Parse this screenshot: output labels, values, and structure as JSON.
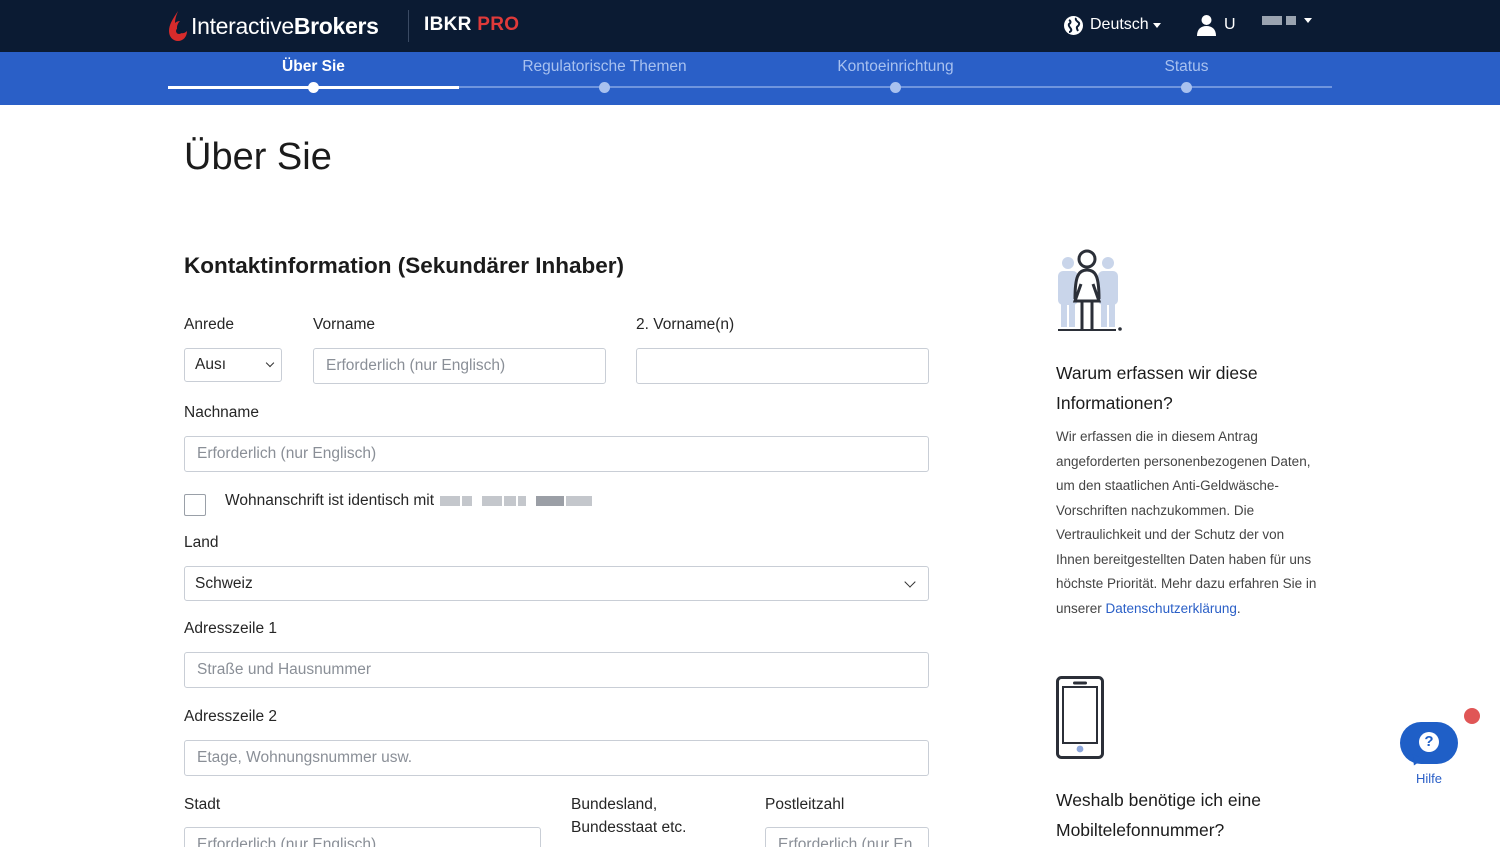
{
  "header": {
    "brand": {
      "light": "Interactive",
      "bold": "Brokers"
    },
    "product": {
      "name": "IBKR",
      "tier": "PRO"
    },
    "language": "Deutsch",
    "user_id": "U"
  },
  "steps": [
    {
      "label": "Über Sie",
      "active": true
    },
    {
      "label": "Regulatorische Themen",
      "active": false
    },
    {
      "label": "Kontoeinrichtung",
      "active": false
    },
    {
      "label": "Status",
      "active": false
    }
  ],
  "page_title": "Über Sie",
  "section_title": "Kontaktinformation (Sekundärer Inhaber)",
  "form": {
    "anrede": {
      "label": "Anrede",
      "value": "Ausı"
    },
    "vorname": {
      "label": "Vorname",
      "placeholder": "Erforderlich (nur Englisch)"
    },
    "vorname2": {
      "label": "2. Vorname(n)",
      "placeholder": ""
    },
    "nachname": {
      "label": "Nachname",
      "placeholder": "Erforderlich (nur Englisch)"
    },
    "same_address": {
      "label": "Wohnanschrift ist identisch mit"
    },
    "land": {
      "label": "Land",
      "value": "Schweiz"
    },
    "adresse1": {
      "label": "Adresszeile 1",
      "placeholder": "Straße und Hausnummer"
    },
    "adresse2": {
      "label": "Adresszeile 2",
      "placeholder": "Etage, Wohnungsnummer usw."
    },
    "stadt": {
      "label": "Stadt",
      "placeholder": "Erforderlich (nur Englisch)"
    },
    "bundesland": {
      "label_line1": "Bundesland,",
      "label_line2": "Bundesstaat etc."
    },
    "plz": {
      "label": "Postleitzahl",
      "placeholder": "Erforderlich (nur En"
    }
  },
  "sidebar": {
    "why_title": "Warum erfassen wir diese Informationen?",
    "why_body": "Wir erfassen die in diesem Antrag angeforderten personenbezogenen Daten, um den staatlichen Anti-Geldwäsche-Vorschriften nachzukommen. Die Vertraulichkeit und der Schutz der von Ihnen bereitgestellten Daten haben für uns höchste Priorität. Mehr dazu erfahren Sie in unserer ",
    "why_link": "Datenschutzerklärung",
    "phone_title": "Weshalb benötige ich eine Mobiltelefonnummer?"
  },
  "help": {
    "label": "Hilfe"
  },
  "colors": {
    "header": "#0b1b33",
    "stepbar": "#2a5fc7",
    "accent_red": "#e03a3a",
    "link": "#2a5fc7"
  },
  "icons": [
    "brand-flame-icon",
    "globe-icon",
    "user-icon",
    "person-group-icon",
    "mobile-phone-icon",
    "question-icon"
  ]
}
